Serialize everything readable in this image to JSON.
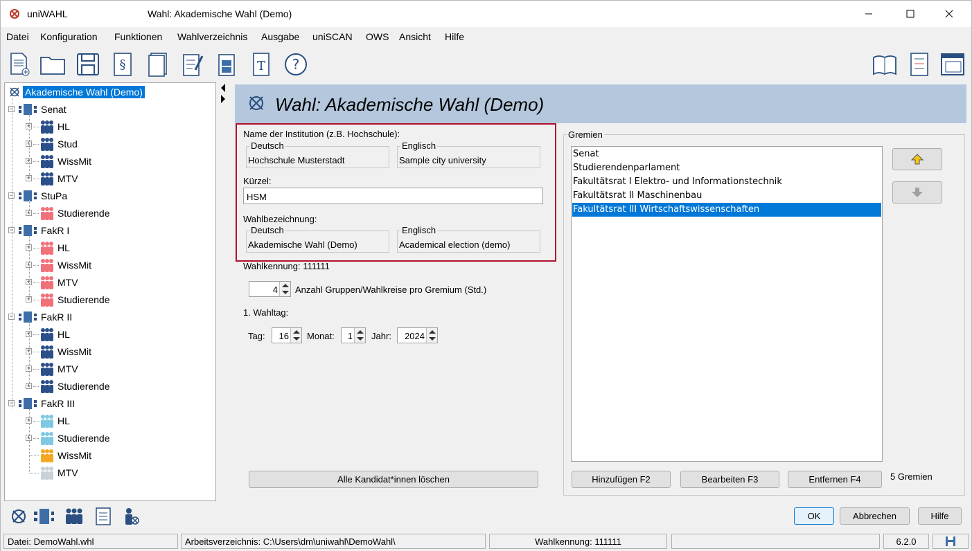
{
  "window": {
    "app_name": "uniWAHL",
    "title": "Wahl:   Akademische Wahl (Demo)"
  },
  "menu": [
    "Datei",
    "Konfiguration",
    "Funktionen",
    "Wahlverzeichnis",
    "Ausgabe",
    "uniSCAN",
    "OWS",
    "Ansicht",
    "Hilfe"
  ],
  "tree": {
    "root": "Akademische Wahl (Demo)",
    "gremien": [
      {
        "name": "Senat",
        "groups": [
          "HL",
          "Stud",
          "WissMit",
          "MTV"
        ],
        "color": "#2b4f8a"
      },
      {
        "name": "StuPa",
        "groups": [
          "Studierende"
        ],
        "color": "#f2707a"
      },
      {
        "name": "FakR I",
        "groups": [
          "HL",
          "WissMit",
          "MTV",
          "Studierende"
        ],
        "color": "#f2707a"
      },
      {
        "name": "FakR II",
        "groups": [
          "HL",
          "WissMit",
          "MTV",
          "Studierende"
        ],
        "color": "#2b4f8a"
      },
      {
        "name": "FakR III",
        "groups": [
          "HL",
          "Studierende",
          "WissMit",
          "MTV"
        ],
        "colors": [
          "#7ec8e3",
          "#7ec8e3",
          "#f5a623",
          "#c8d0d8"
        ]
      }
    ]
  },
  "main": {
    "header_title": "Wahl: Akademische Wahl (Demo)",
    "institution_label": "Name der Institution (z.B. Hochschule):",
    "deutsch_label": "Deutsch",
    "englisch_label": "Englisch",
    "institution_de": "Hochschule Musterstadt",
    "institution_en": "Sample city university",
    "kuerzel_label": "Kürzel:",
    "kuerzel_value": "HSM",
    "wahlbezeichnung_label": "Wahlbezeichnung:",
    "wahl_de": "Akademische Wahl (Demo)",
    "wahl_en": "Academical election (demo)",
    "wahlkennung_label": "Wahlkennung: 111111",
    "anzahl_value": "4",
    "anzahl_label": "Anzahl Gruppen/Wahlkreise pro Gremium (Std.)",
    "wahltag_label": "1. Wahltag:",
    "tag_label": "Tag:",
    "tag_value": "16",
    "monat_label": "Monat:",
    "monat_value": "1",
    "jahr_label": "Jahr:",
    "jahr_value": "2024",
    "delete_button": "Alle Kandidat*innen löschen"
  },
  "gremien": {
    "legend": "Gremien",
    "items": [
      "Senat",
      "Studierendenparlament",
      "Fakultätsrat I Elektro- und Informationstechnik",
      "Fakultätsrat II Maschinenbau",
      "Fakultätsrat III Wirtschaftswissenschaften"
    ],
    "selected_index": 4,
    "add_button": "Hinzufügen F2",
    "edit_button": "Bearbeiten F3",
    "remove_button": "Entfernen F4",
    "count": "5 Gremien"
  },
  "dialog": {
    "ok": "OK",
    "cancel": "Abbrechen",
    "help": "Hilfe"
  },
  "status": {
    "file": "Datei: DemoWahl.whl",
    "workdir": "Arbeitsverzeichnis: C:\\Users\\dm\\uniwahl\\DemoWahl\\",
    "wahlkennung": "Wahlkennung: 111111",
    "empty": "",
    "version": "6.2.0"
  }
}
